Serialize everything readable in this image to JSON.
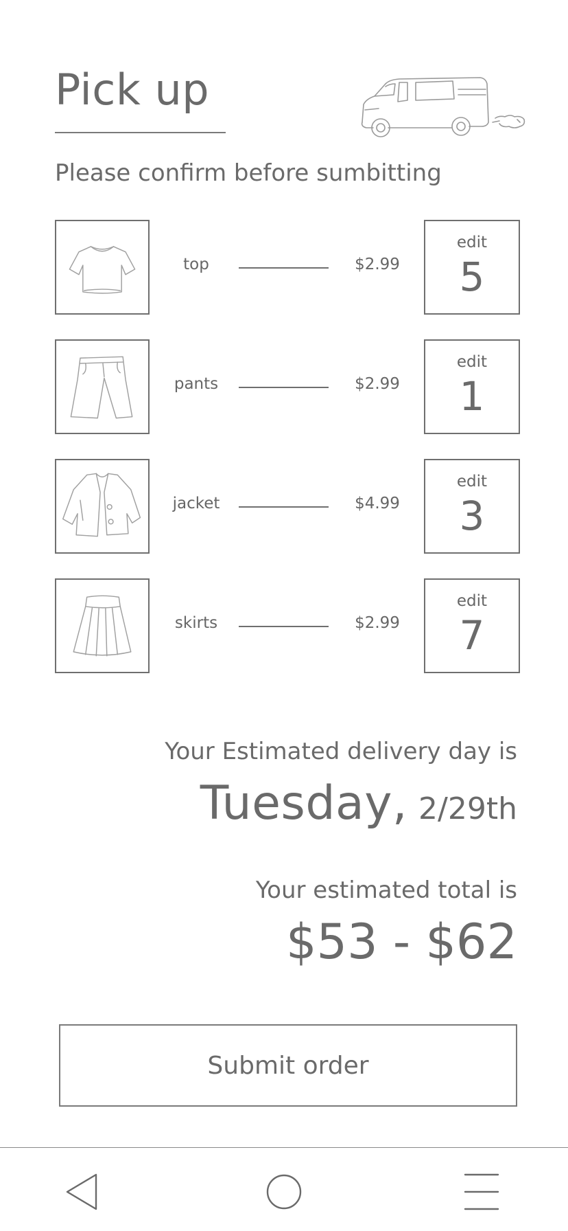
{
  "header": {
    "title": "Pick up",
    "subtitle": "Please confirm before sumbitting",
    "van_icon": "van-icon"
  },
  "items": [
    {
      "name": "top",
      "price": "$2.99",
      "edit_label": "edit",
      "quantity": "5",
      "icon": "shirt-icon"
    },
    {
      "name": "pants",
      "price": "$2.99",
      "edit_label": "edit",
      "quantity": "1",
      "icon": "pants-icon"
    },
    {
      "name": "jacket",
      "price": "$4.99",
      "edit_label": "edit",
      "quantity": "3",
      "icon": "jacket-icon"
    },
    {
      "name": "skirts",
      "price": "$2.99",
      "edit_label": "edit",
      "quantity": "7",
      "icon": "skirt-icon"
    }
  ],
  "delivery": {
    "label": "Your Estimated delivery day is",
    "day": "Tuesday,",
    "date": "2/29th"
  },
  "total": {
    "label": "Your estimated total is",
    "value": "$53 - $62"
  },
  "submit": {
    "label": "Submit order"
  },
  "nav": {
    "back_icon": "back-triangle-icon",
    "home_icon": "home-circle-icon",
    "menu_icon": "menu-lines-icon"
  },
  "colors": {
    "text": "#666666",
    "border": "#6f6f6f",
    "sketch": "#9a9a9a",
    "background": "#ffffff"
  }
}
